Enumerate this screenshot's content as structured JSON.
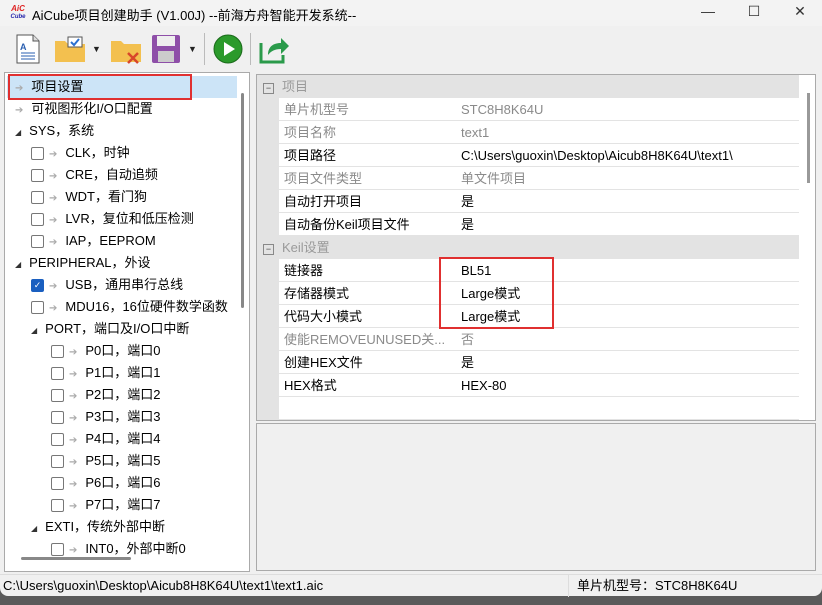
{
  "window": {
    "title": "AiCube项目创建助手 (V1.00J) --前海方舟智能开发系统--",
    "logo_top": "AiC",
    "logo_bottom": "Cube",
    "minimize": "—",
    "maximize": "☐",
    "close": "✕"
  },
  "tree": [
    {
      "label": "项目设置",
      "level": 0,
      "type": "arrow",
      "selected": true
    },
    {
      "label": "可视图形化I/O口配置",
      "level": 0,
      "type": "arrow"
    },
    {
      "label": "SYS，系统",
      "level": 0,
      "type": "expander"
    },
    {
      "label": "CLK，时钟",
      "level": 1,
      "type": "check",
      "checked": false
    },
    {
      "label": "CRE，自动追频",
      "level": 1,
      "type": "check",
      "checked": false
    },
    {
      "label": "WDT，看门狗",
      "level": 1,
      "type": "check",
      "checked": false
    },
    {
      "label": "LVR，复位和低压检测",
      "level": 1,
      "type": "check",
      "checked": false
    },
    {
      "label": "IAP，EEPROM",
      "level": 1,
      "type": "check",
      "checked": false
    },
    {
      "label": "PERIPHERAL，外设",
      "level": 0,
      "type": "expander"
    },
    {
      "label": "USB，通用串行总线",
      "level": 1,
      "type": "check",
      "checked": true
    },
    {
      "label": "MDU16，16位硬件数学函数",
      "level": 1,
      "type": "check",
      "checked": false
    },
    {
      "label": "PORT，端口及I/O口中断",
      "level": 1,
      "type": "expander"
    },
    {
      "label": "P0口，端口0",
      "level": 2,
      "type": "check",
      "checked": false
    },
    {
      "label": "P1口，端口1",
      "level": 2,
      "type": "check",
      "checked": false
    },
    {
      "label": "P2口，端口2",
      "level": 2,
      "type": "check",
      "checked": false
    },
    {
      "label": "P3口，端口3",
      "level": 2,
      "type": "check",
      "checked": false
    },
    {
      "label": "P4口，端口4",
      "level": 2,
      "type": "check",
      "checked": false
    },
    {
      "label": "P5口，端口5",
      "level": 2,
      "type": "check",
      "checked": false
    },
    {
      "label": "P6口，端口6",
      "level": 2,
      "type": "check",
      "checked": false
    },
    {
      "label": "P7口，端口7",
      "level": 2,
      "type": "check",
      "checked": false
    },
    {
      "label": "EXTI，传统外部中断",
      "level": 1,
      "type": "expander"
    },
    {
      "label": "INT0，外部中断0",
      "level": 2,
      "type": "check",
      "checked": false
    }
  ],
  "properties": {
    "cat1": "项目",
    "rows1": [
      {
        "name": "单片机型号",
        "value": "STC8H8K64U",
        "disabled": true
      },
      {
        "name": "项目名称",
        "value": "text1",
        "disabled": true
      },
      {
        "name": "项目路径",
        "value": "C:\\Users\\guoxin\\Desktop\\Aicub8H8K64U\\text1\\",
        "disabled": false
      },
      {
        "name": "项目文件类型",
        "value": "单文件项目",
        "disabled": true
      },
      {
        "name": "自动打开项目",
        "value": "是",
        "disabled": false
      },
      {
        "name": "自动备份Keil项目文件",
        "value": "是",
        "disabled": false
      }
    ],
    "cat2": "Keil设置",
    "rows2": [
      {
        "name": "链接器",
        "value": "BL51",
        "disabled": false
      },
      {
        "name": "存储器模式",
        "value": "Large模式",
        "disabled": false
      },
      {
        "name": "代码大小模式",
        "value": "Large模式",
        "disabled": false
      },
      {
        "name": "使能REMOVEUNUSED关...",
        "value": "否",
        "disabled": true
      },
      {
        "name": "创建HEX文件",
        "value": "是",
        "disabled": false
      },
      {
        "name": "HEX格式",
        "value": "HEX-80",
        "disabled": false
      }
    ]
  },
  "status": {
    "path": "C:\\Users\\guoxin\\Desktop\\Aicub8H8K64U\\text1\\text1.aic",
    "chip": "单片机型号：STC8H8K64U"
  }
}
